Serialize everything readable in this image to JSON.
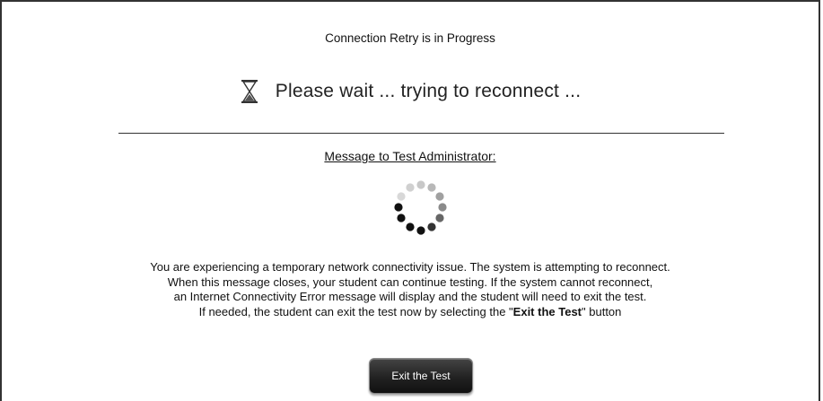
{
  "dialog": {
    "title": "Connection Retry is in Progress",
    "wait_message": "Please wait ... trying to reconnect ...",
    "admin_heading": "Message to Test Administrator:",
    "body_lines": [
      "You are experiencing a temporary network connectivity issue. The system is attempting to reconnect.",
      "When this message closes, your student can continue testing. If the system cannot reconnect,",
      "an Internet Connectivity Error message will display and the student will need to exit the test."
    ],
    "body_last_prefix": "If needed, the student can exit the test now by selecting the \"",
    "body_last_bold": "Exit the Test",
    "body_last_suffix": "\" button",
    "exit_button_label": "Exit the Test"
  },
  "icons": {
    "hourglass": "hourglass-icon",
    "spinner": "loading-spinner-icon"
  }
}
